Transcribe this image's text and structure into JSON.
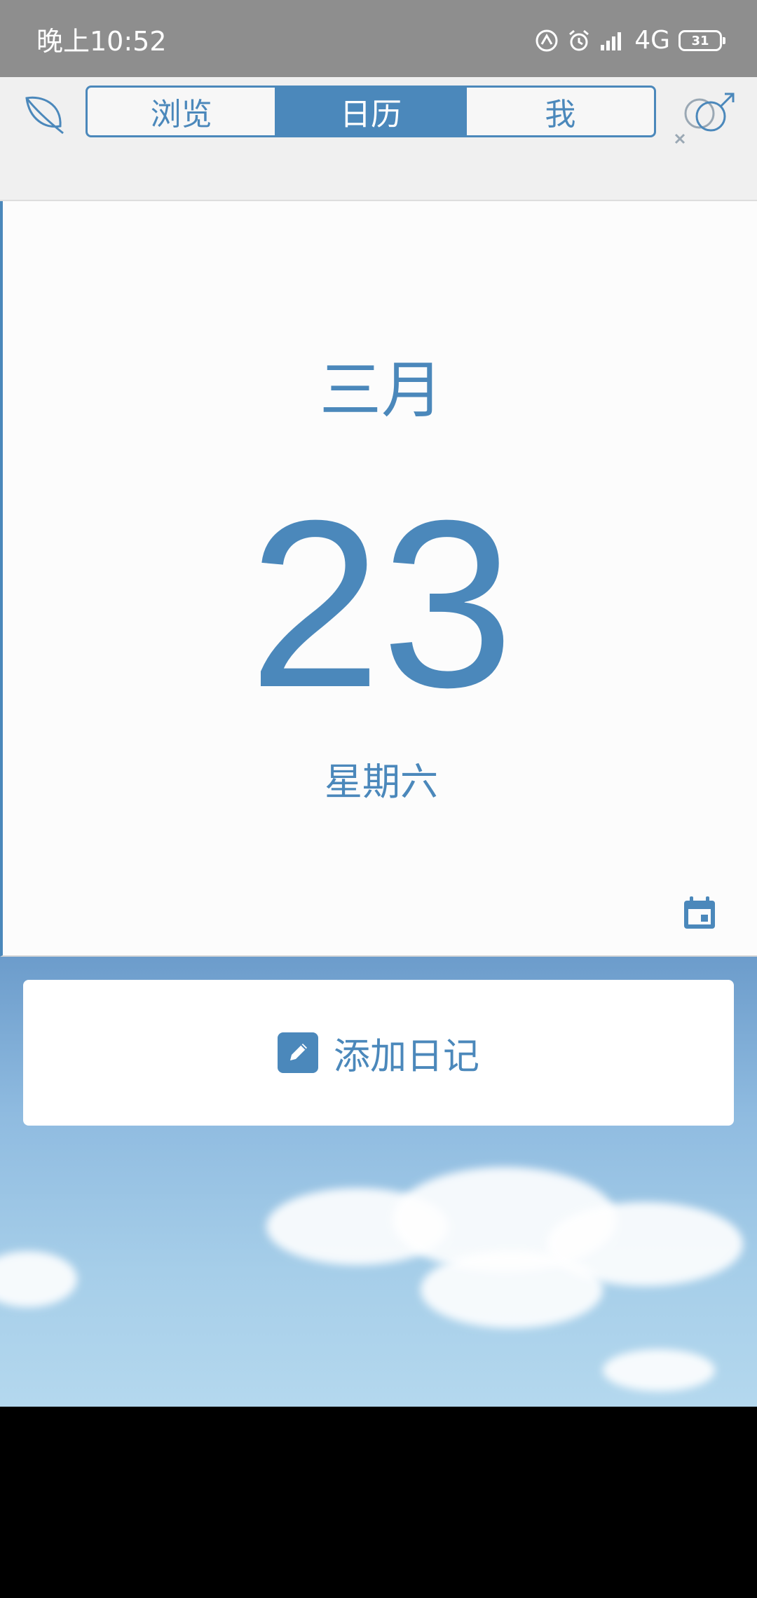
{
  "status_bar": {
    "time": "晚上10:52",
    "network": "4G",
    "battery": "31",
    "icons": [
      "nfc-icon",
      "alarm-icon",
      "signal-icon",
      "battery-icon"
    ]
  },
  "top_bar": {
    "tabs": [
      {
        "label": "浏览",
        "active": false
      },
      {
        "label": "日历",
        "active": true
      },
      {
        "label": "我",
        "active": false
      }
    ],
    "left_icon": "leaf-icon",
    "right_icon": "gender-icon"
  },
  "calendar": {
    "month": "三月",
    "day": "23",
    "weekday": "星期六",
    "icon": "calendar-icon"
  },
  "add_diary": {
    "label": "添加日记",
    "icon": "pencil-icon"
  },
  "colors": {
    "accent": "#4b88bb",
    "status_bar_bg": "#8e8e8e",
    "top_bar_bg": "#f0f0f0",
    "card_bg": "#fcfcfc"
  }
}
